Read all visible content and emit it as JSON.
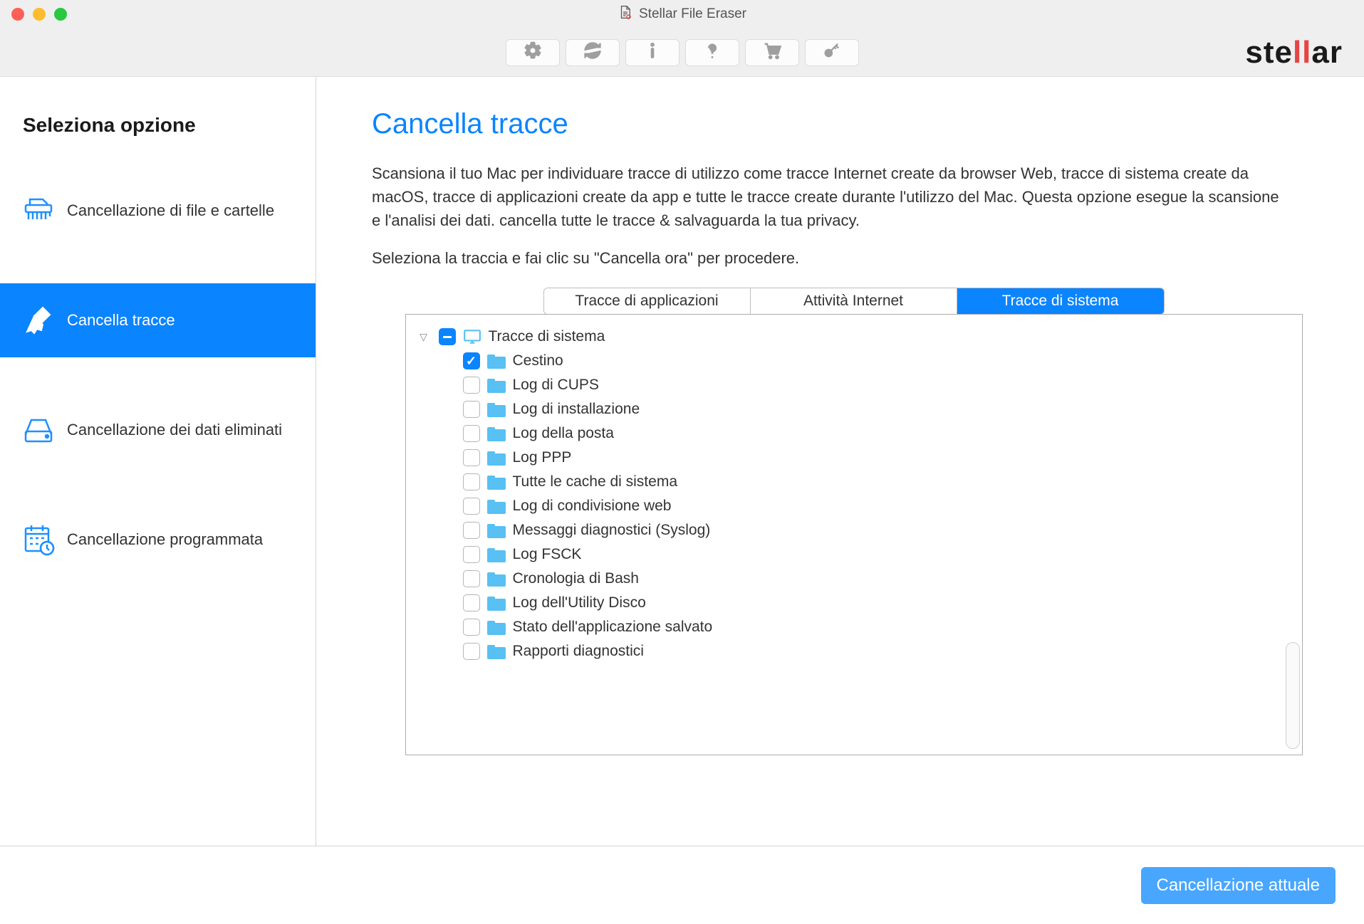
{
  "window": {
    "title": "Stellar File Eraser"
  },
  "brand": "stellar",
  "sidebar": {
    "header": "Seleziona opzione",
    "items": [
      {
        "label": "Cancellazione di file e cartelle"
      },
      {
        "label": "Cancella tracce"
      },
      {
        "label": "Cancellazione dei dati eliminati"
      },
      {
        "label": "Cancellazione programmata"
      }
    ]
  },
  "main": {
    "title": "Cancella tracce",
    "description": "Scansiona il tuo Mac per individuare tracce di utilizzo come tracce Internet create da browser Web, tracce di sistema create da macOS, tracce di applicazioni create da app e tutte le tracce create durante l'utilizzo del Mac. Questa opzione esegue la scansione e l'analisi dei dati. cancella tutte le tracce & salvaguarda la tua privacy.",
    "subline": "Seleziona la traccia e fai clic su \"Cancella ora\" per procedere.",
    "tabs": [
      {
        "label": "Tracce di applicazioni"
      },
      {
        "label": "Attività Internet"
      },
      {
        "label": "Tracce di sistema"
      }
    ],
    "tree": {
      "root": {
        "label": "Tracce di sistema",
        "state": "indeterminate"
      },
      "items": [
        {
          "label": "Cestino",
          "checked": true
        },
        {
          "label": "Log di CUPS",
          "checked": false
        },
        {
          "label": "Log di installazione",
          "checked": false
        },
        {
          "label": "Log della posta",
          "checked": false
        },
        {
          "label": "Log PPP",
          "checked": false
        },
        {
          "label": "Tutte le cache di sistema",
          "checked": false
        },
        {
          "label": "Log di condivisione web",
          "checked": false
        },
        {
          "label": "Messaggi diagnostici (Syslog)",
          "checked": false
        },
        {
          "label": "Log FSCK",
          "checked": false
        },
        {
          "label": "Cronologia di Bash",
          "checked": false
        },
        {
          "label": "Log dell'Utility Disco",
          "checked": false
        },
        {
          "label": "Stato dell'applicazione salvato",
          "checked": false
        },
        {
          "label": "Rapporti diagnostici",
          "checked": false
        }
      ]
    }
  },
  "footer": {
    "primary_button": "Cancellazione attuale"
  }
}
